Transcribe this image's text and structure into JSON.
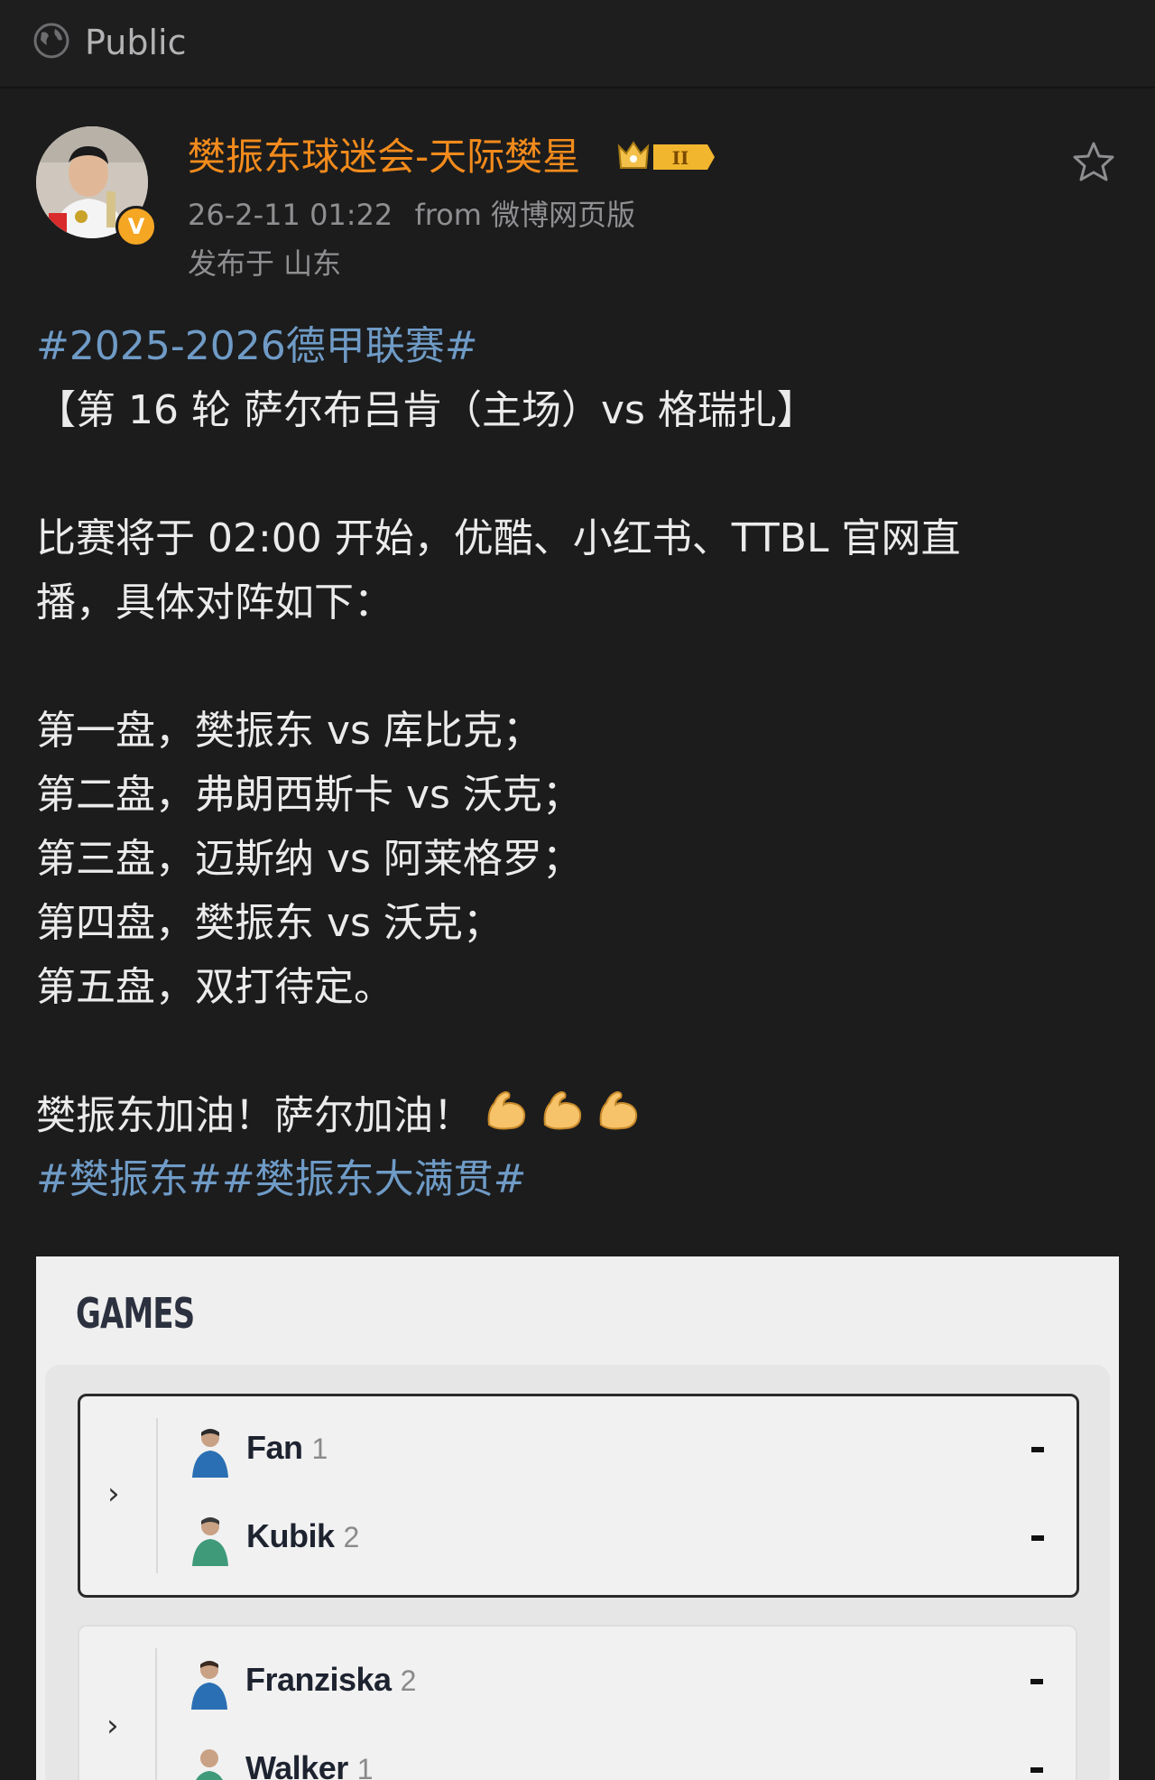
{
  "topbar": {
    "visibility": "Public",
    "icon": "globe-icon"
  },
  "post": {
    "username": "樊振东球迷会-天际樊星",
    "badge_level": "II",
    "timestamp": "26-2-11 01:22",
    "source": "from 微博网页版",
    "location": "发布于 山东",
    "body": {
      "hashtag1": "#2025-2026德甲联赛#",
      "title": "【第 16 轮 萨尔布吕肯（主场）vs 格瑞扎】",
      "intro1": "比赛将于 02:00 开始，优酷、小红书、TTBL 官网直",
      "intro2": "播，具体对阵如下：",
      "game1": "第一盘，樊振东 vs 库比克；",
      "game2": "第二盘，弗朗西斯卡 vs 沃克；",
      "game3": "第三盘，迈斯纳 vs 阿莱格罗；",
      "game4": "第四盘，樊振东 vs 沃克；",
      "game5": "第五盘，双打待定。",
      "cheer": "樊振东加油！萨尔加油！",
      "hashtags_end": "#樊振东##樊振东大满贯#"
    },
    "emojis": [
      "flexed-biceps-icon",
      "flexed-biceps-icon",
      "flexed-biceps-icon"
    ]
  },
  "games": {
    "title": "GAMES",
    "matches": [
      {
        "players": [
          {
            "name": "Fan",
            "seed": "1",
            "score": "-"
          },
          {
            "name": "Kubik",
            "seed": "2",
            "score": "-"
          }
        ]
      },
      {
        "players": [
          {
            "name": "Franziska",
            "seed": "2",
            "score": "-"
          },
          {
            "name": "Walker",
            "seed": "1",
            "score": "-"
          }
        ]
      }
    ]
  },
  "colors": {
    "username": "#f28b1c",
    "hashtag": "#6f9bc6",
    "background": "#1c1c1d"
  }
}
